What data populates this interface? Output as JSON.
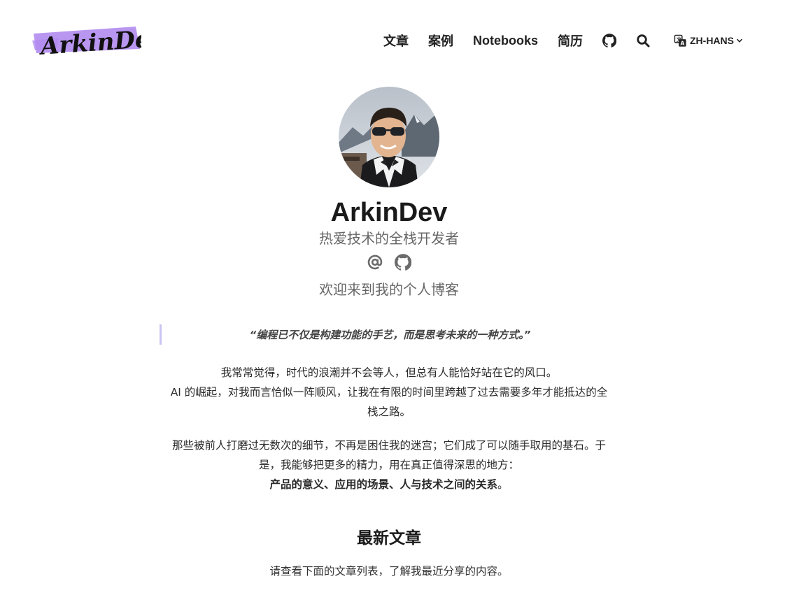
{
  "header": {
    "logo_text": "ArkinDev",
    "brand_color": "#b18cf0",
    "nav": [
      {
        "label": "文章"
      },
      {
        "label": "案例"
      },
      {
        "label": "Notebooks"
      },
      {
        "label": "简历"
      }
    ],
    "github_icon": "github-icon",
    "search_icon": "search-icon",
    "language": {
      "label": "ZH-HANS",
      "icon": "translate-icon"
    }
  },
  "profile": {
    "name": "ArkinDev",
    "role": "热爱技术的全栈开发者",
    "welcome": "欢迎来到我的个人博客",
    "social_icons": [
      "at-icon",
      "github-icon"
    ]
  },
  "content": {
    "quote": "“编程已不仅是构建功能的手艺，而是思考未来的一种方式。”",
    "para1_line1": "我常常觉得，时代的浪潮并不会等人，但总有人能恰好站在它的风口。",
    "para1_line2": "AI 的崛起，对我而言恰似一阵顺风，让我在有限的时间里跨越了过去需要多年才能抵达的全",
    "para1_line3": "栈之路。",
    "para2_line1": "那些被前人打磨过无数次的细节，不再是困住我的迷宫；它们成了可以随手取用的基石。于",
    "para2_line2": "是，我能够把更多的精力，用在真正值得深思的地方：",
    "para2_bold": "产品的意义、应用的场景、人与技术之间的关系",
    "para2_tail": "。",
    "section_title": "最新文章",
    "section_desc": "请查看下面的文章列表，了解我最近分享的内容。"
  }
}
